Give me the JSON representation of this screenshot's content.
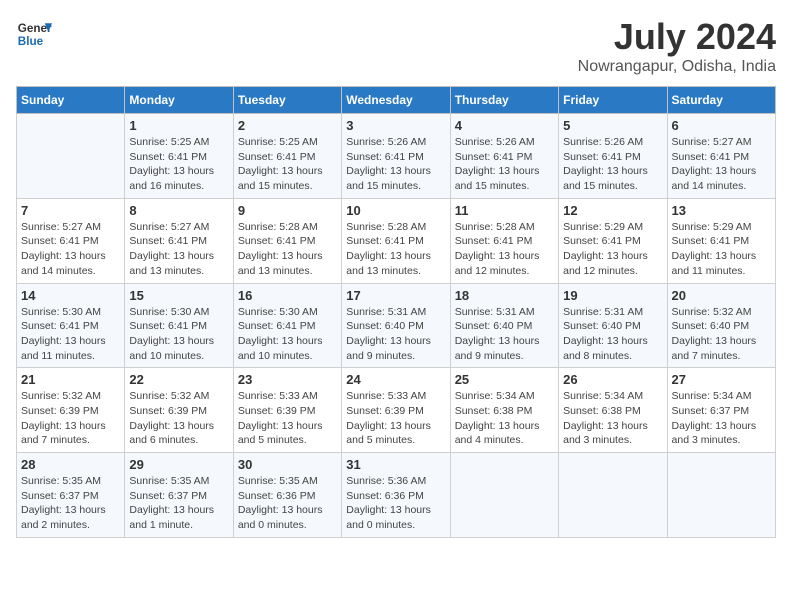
{
  "header": {
    "logo_line1": "General",
    "logo_line2": "Blue",
    "title": "July 2024",
    "subtitle": "Nowrangapur, Odisha, India"
  },
  "calendar": {
    "days_of_week": [
      "Sunday",
      "Monday",
      "Tuesday",
      "Wednesday",
      "Thursday",
      "Friday",
      "Saturday"
    ],
    "weeks": [
      [
        {
          "day": "",
          "info": ""
        },
        {
          "day": "1",
          "info": "Sunrise: 5:25 AM\nSunset: 6:41 PM\nDaylight: 13 hours\nand 16 minutes."
        },
        {
          "day": "2",
          "info": "Sunrise: 5:25 AM\nSunset: 6:41 PM\nDaylight: 13 hours\nand 15 minutes."
        },
        {
          "day": "3",
          "info": "Sunrise: 5:26 AM\nSunset: 6:41 PM\nDaylight: 13 hours\nand 15 minutes."
        },
        {
          "day": "4",
          "info": "Sunrise: 5:26 AM\nSunset: 6:41 PM\nDaylight: 13 hours\nand 15 minutes."
        },
        {
          "day": "5",
          "info": "Sunrise: 5:26 AM\nSunset: 6:41 PM\nDaylight: 13 hours\nand 15 minutes."
        },
        {
          "day": "6",
          "info": "Sunrise: 5:27 AM\nSunset: 6:41 PM\nDaylight: 13 hours\nand 14 minutes."
        }
      ],
      [
        {
          "day": "7",
          "info": "Sunrise: 5:27 AM\nSunset: 6:41 PM\nDaylight: 13 hours\nand 14 minutes."
        },
        {
          "day": "8",
          "info": "Sunrise: 5:27 AM\nSunset: 6:41 PM\nDaylight: 13 hours\nand 13 minutes."
        },
        {
          "day": "9",
          "info": "Sunrise: 5:28 AM\nSunset: 6:41 PM\nDaylight: 13 hours\nand 13 minutes."
        },
        {
          "day": "10",
          "info": "Sunrise: 5:28 AM\nSunset: 6:41 PM\nDaylight: 13 hours\nand 13 minutes."
        },
        {
          "day": "11",
          "info": "Sunrise: 5:28 AM\nSunset: 6:41 PM\nDaylight: 13 hours\nand 12 minutes."
        },
        {
          "day": "12",
          "info": "Sunrise: 5:29 AM\nSunset: 6:41 PM\nDaylight: 13 hours\nand 12 minutes."
        },
        {
          "day": "13",
          "info": "Sunrise: 5:29 AM\nSunset: 6:41 PM\nDaylight: 13 hours\nand 11 minutes."
        }
      ],
      [
        {
          "day": "14",
          "info": "Sunrise: 5:30 AM\nSunset: 6:41 PM\nDaylight: 13 hours\nand 11 minutes."
        },
        {
          "day": "15",
          "info": "Sunrise: 5:30 AM\nSunset: 6:41 PM\nDaylight: 13 hours\nand 10 minutes."
        },
        {
          "day": "16",
          "info": "Sunrise: 5:30 AM\nSunset: 6:41 PM\nDaylight: 13 hours\nand 10 minutes."
        },
        {
          "day": "17",
          "info": "Sunrise: 5:31 AM\nSunset: 6:40 PM\nDaylight: 13 hours\nand 9 minutes."
        },
        {
          "day": "18",
          "info": "Sunrise: 5:31 AM\nSunset: 6:40 PM\nDaylight: 13 hours\nand 9 minutes."
        },
        {
          "day": "19",
          "info": "Sunrise: 5:31 AM\nSunset: 6:40 PM\nDaylight: 13 hours\nand 8 minutes."
        },
        {
          "day": "20",
          "info": "Sunrise: 5:32 AM\nSunset: 6:40 PM\nDaylight: 13 hours\nand 7 minutes."
        }
      ],
      [
        {
          "day": "21",
          "info": "Sunrise: 5:32 AM\nSunset: 6:39 PM\nDaylight: 13 hours\nand 7 minutes."
        },
        {
          "day": "22",
          "info": "Sunrise: 5:32 AM\nSunset: 6:39 PM\nDaylight: 13 hours\nand 6 minutes."
        },
        {
          "day": "23",
          "info": "Sunrise: 5:33 AM\nSunset: 6:39 PM\nDaylight: 13 hours\nand 5 minutes."
        },
        {
          "day": "24",
          "info": "Sunrise: 5:33 AM\nSunset: 6:39 PM\nDaylight: 13 hours\nand 5 minutes."
        },
        {
          "day": "25",
          "info": "Sunrise: 5:34 AM\nSunset: 6:38 PM\nDaylight: 13 hours\nand 4 minutes."
        },
        {
          "day": "26",
          "info": "Sunrise: 5:34 AM\nSunset: 6:38 PM\nDaylight: 13 hours\nand 3 minutes."
        },
        {
          "day": "27",
          "info": "Sunrise: 5:34 AM\nSunset: 6:37 PM\nDaylight: 13 hours\nand 3 minutes."
        }
      ],
      [
        {
          "day": "28",
          "info": "Sunrise: 5:35 AM\nSunset: 6:37 PM\nDaylight: 13 hours\nand 2 minutes."
        },
        {
          "day": "29",
          "info": "Sunrise: 5:35 AM\nSunset: 6:37 PM\nDaylight: 13 hours\nand 1 minute."
        },
        {
          "day": "30",
          "info": "Sunrise: 5:35 AM\nSunset: 6:36 PM\nDaylight: 13 hours\nand 0 minutes."
        },
        {
          "day": "31",
          "info": "Sunrise: 5:36 AM\nSunset: 6:36 PM\nDaylight: 13 hours\nand 0 minutes."
        },
        {
          "day": "",
          "info": ""
        },
        {
          "day": "",
          "info": ""
        },
        {
          "day": "",
          "info": ""
        }
      ]
    ]
  }
}
